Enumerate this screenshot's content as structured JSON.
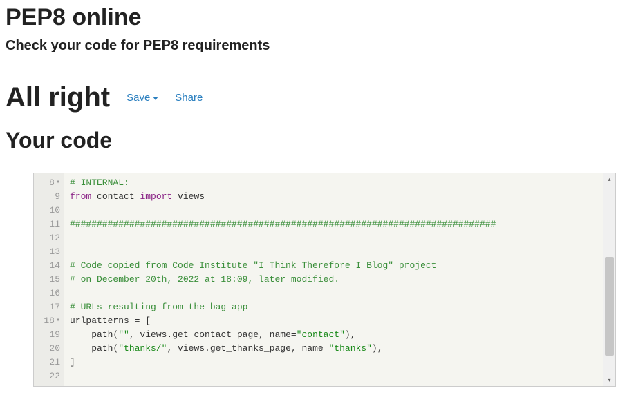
{
  "header": {
    "title": "PEP8 online",
    "subtitle": "Check your code for PEP8 requirements"
  },
  "result": {
    "heading": "All right",
    "save_label": "Save",
    "share_label": "Share"
  },
  "section": {
    "your_code": "Your code"
  },
  "editor": {
    "first_line_no": 8,
    "gutter": [
      "8",
      "9",
      "10",
      "11",
      "12",
      "13",
      "14",
      "15",
      "16",
      "17",
      "18",
      "19",
      "20",
      "21",
      "22"
    ],
    "fold_lines": [
      8,
      18
    ],
    "lines": [
      {
        "segments": [
          {
            "cls": "tok-comment",
            "text": "# INTERNAL:"
          }
        ]
      },
      {
        "segments": [
          {
            "cls": "tok-kw",
            "text": "from"
          },
          {
            "cls": "tok-ident",
            "text": " contact "
          },
          {
            "cls": "tok-kw",
            "text": "import"
          },
          {
            "cls": "tok-ident",
            "text": " views"
          }
        ]
      },
      {
        "segments": []
      },
      {
        "segments": [
          {
            "cls": "tok-comment",
            "text": "###############################################################################"
          }
        ]
      },
      {
        "segments": []
      },
      {
        "segments": []
      },
      {
        "segments": [
          {
            "cls": "tok-comment",
            "text": "# Code copied from Code Institute \"I Think Therefore I Blog\" project"
          }
        ]
      },
      {
        "segments": [
          {
            "cls": "tok-comment",
            "text": "# on December 20th, 2022 at 18:09, later modified."
          }
        ]
      },
      {
        "segments": []
      },
      {
        "segments": [
          {
            "cls": "tok-comment",
            "text": "# URLs resulting from the bag app"
          }
        ]
      },
      {
        "segments": [
          {
            "cls": "tok-ident",
            "text": "urlpatterns = ["
          }
        ]
      },
      {
        "segments": [
          {
            "cls": "tok-ident",
            "text": "    path("
          },
          {
            "cls": "tok-str",
            "text": "\"\""
          },
          {
            "cls": "tok-ident",
            "text": ", views.get_contact_page, name="
          },
          {
            "cls": "tok-str",
            "text": "\"contact\""
          },
          {
            "cls": "tok-ident",
            "text": "),"
          }
        ]
      },
      {
        "segments": [
          {
            "cls": "tok-ident",
            "text": "    path("
          },
          {
            "cls": "tok-str",
            "text": "\"thanks/\""
          },
          {
            "cls": "tok-ident",
            "text": ", views.get_thanks_page, name="
          },
          {
            "cls": "tok-str",
            "text": "\"thanks\""
          },
          {
            "cls": "tok-ident",
            "text": "),"
          }
        ]
      },
      {
        "segments": [
          {
            "cls": "tok-ident",
            "text": "]"
          }
        ]
      },
      {
        "segments": []
      }
    ]
  }
}
